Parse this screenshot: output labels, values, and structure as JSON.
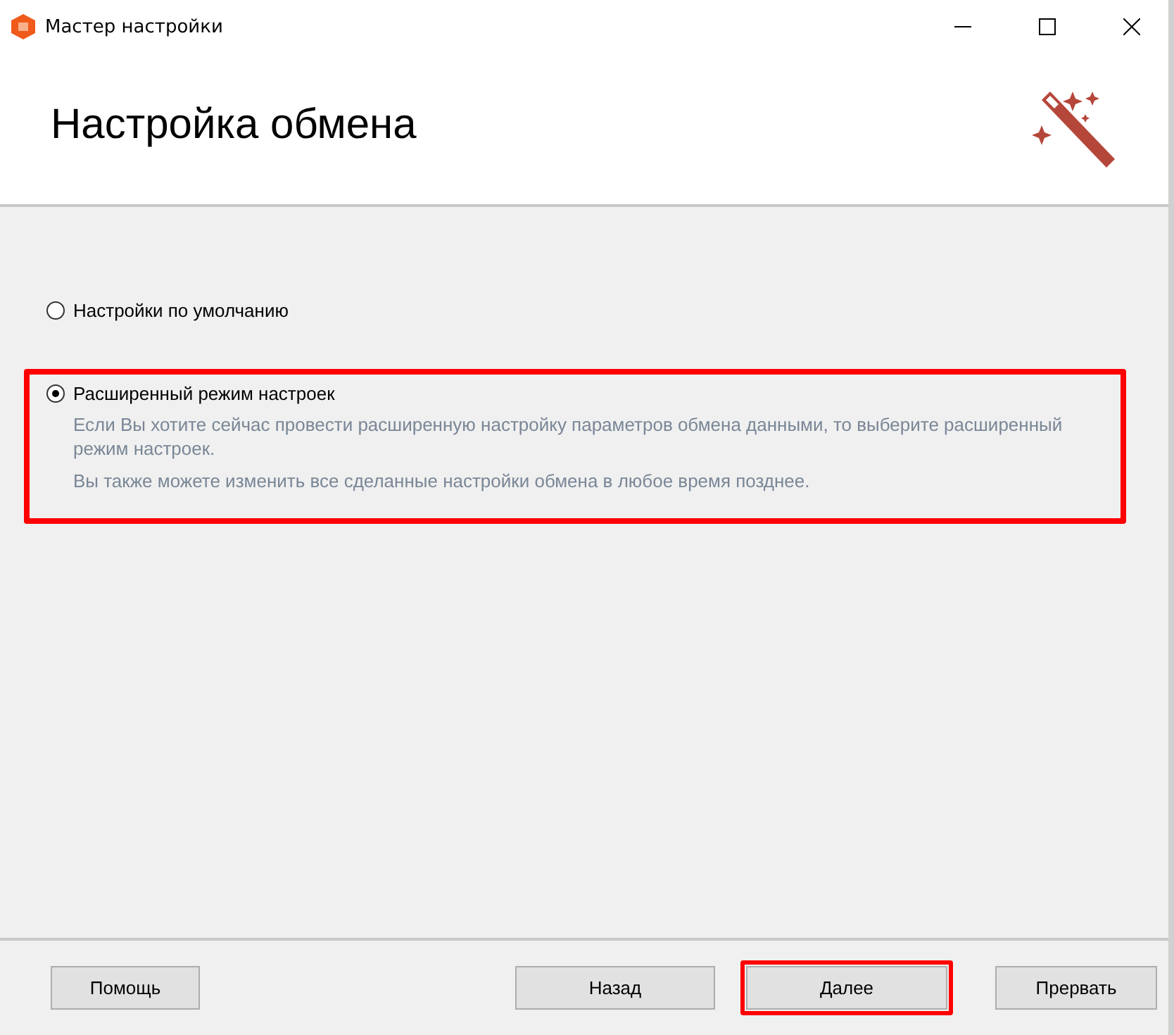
{
  "window": {
    "title": "Мастер настройки"
  },
  "header": {
    "title": "Настройка обмена"
  },
  "options": [
    {
      "label": "Настройки по умолчанию",
      "selected": false,
      "highlighted": false
    },
    {
      "label": "Расширенный режим настроек",
      "selected": true,
      "highlighted": true,
      "descriptions": [
        "Если Вы хотите сейчас провести расширенную настройку параметров обмена данными, то выберите расширенный режим настроек.",
        "Вы также можете изменить все сделанные настройки обмена в любое время позднее."
      ]
    }
  ],
  "buttons": [
    {
      "label": "Помощь",
      "highlighted": false
    },
    {
      "label": "Назад",
      "highlighted": false
    },
    {
      "label": "Далее",
      "highlighted": true
    },
    {
      "label": "Прервать",
      "highlighted": false
    }
  ]
}
